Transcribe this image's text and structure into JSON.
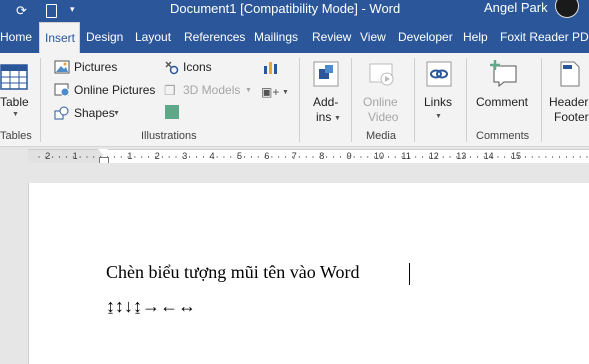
{
  "title_bar": {
    "title": "Document1 [Compatibility Mode] - Word",
    "user": "Angel Park"
  },
  "tabs": [
    {
      "label": "Home"
    },
    {
      "label": "Insert"
    },
    {
      "label": "Design"
    },
    {
      "label": "Layout"
    },
    {
      "label": "References"
    },
    {
      "label": "Mailings"
    },
    {
      "label": "Review"
    },
    {
      "label": "View"
    },
    {
      "label": "Developer"
    },
    {
      "label": "Help"
    },
    {
      "label": "Foxit Reader PDF"
    }
  ],
  "ribbon": {
    "tables": {
      "button": "Table",
      "group": "Tables"
    },
    "illustrations": {
      "pictures": "Pictures",
      "online_pictures": "Online Pictures",
      "shapes": "Shapes",
      "icons": "Icons",
      "models_3d": "3D Models",
      "group": "Illustrations"
    },
    "addins": {
      "line1": "Add-",
      "line2": "ins"
    },
    "media": {
      "line1": "Online",
      "line2": "Video",
      "group": "Media"
    },
    "links": {
      "label": "Links"
    },
    "comments": {
      "label": "Comment",
      "group": "Comments"
    },
    "header": {
      "line1": "Header",
      "line2": "Footer"
    }
  },
  "ruler": {
    "labels": [
      "2",
      "1",
      "1",
      "2",
      "3",
      "4",
      "5",
      "6",
      "7",
      "8",
      "9",
      "10",
      "11",
      "12",
      "13",
      "14",
      "15"
    ]
  },
  "document": {
    "line1": "Chèn biểu tượng mũi tên vào Word",
    "line2": "↨↕↓↨→←↔"
  },
  "colors": {
    "word_blue": "#2b579a",
    "ribbon_bg": "#f3f3f3",
    "canvas_bg": "#e6e6e6"
  }
}
